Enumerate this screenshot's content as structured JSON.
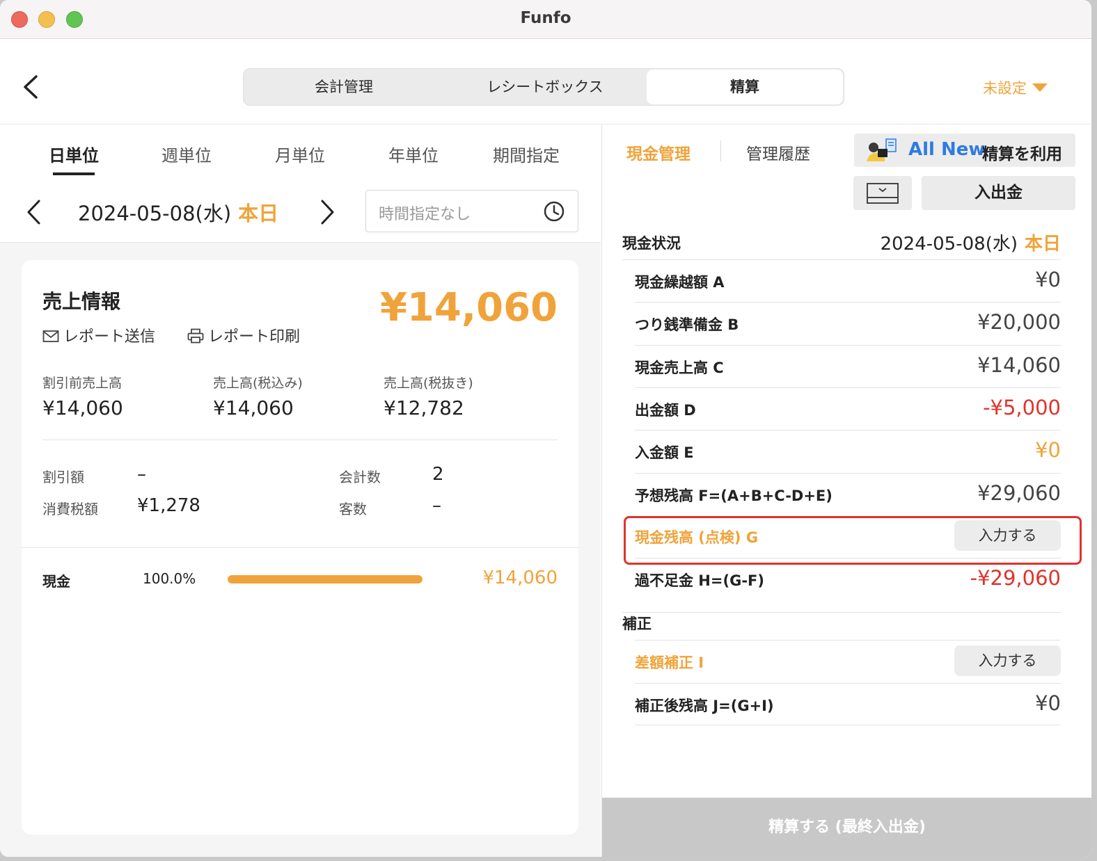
{
  "window": {
    "title": "Funfo"
  },
  "header": {
    "segments": [
      "会計管理",
      "レシートボックス",
      "精算"
    ],
    "unset_label": "未設定"
  },
  "left": {
    "period_tabs": [
      "日単位",
      "週単位",
      "月単位",
      "年単位",
      "期間指定"
    ],
    "date": "2024-05-08(水)",
    "today_label": "本日",
    "time_placeholder": "時間指定なし",
    "card": {
      "title": "売上情報",
      "total": "¥14,060",
      "report_send": "レポート送信",
      "report_print": "レポート印刷",
      "stats": [
        {
          "label": "割引前売上高",
          "value": "¥14,060"
        },
        {
          "label": "売上高(税込み)",
          "value": "¥14,060"
        },
        {
          "label": "売上高(税抜き)",
          "value": "¥12,782"
        }
      ],
      "discount_label": "割引額",
      "discount_value": "–",
      "tax_label": "消費税額",
      "tax_value": "¥1,278",
      "count_label": "会計数",
      "count_value": "2",
      "customers_label": "客数",
      "customers_value": "–",
      "payment": {
        "name": "現金",
        "percent": "100.0%",
        "fraction": 1.0,
        "amount": "¥14,060"
      }
    }
  },
  "right": {
    "tabs": [
      "現金管理",
      "管理履歴"
    ],
    "promo_new": "All New",
    "promo_text": "精算を利用",
    "io_button": "入出金",
    "status_header": "現金状況",
    "status_date": "2024-05-08(水)",
    "today_label": "本日",
    "rows": [
      {
        "label": "現金繰越額 A",
        "value": "¥0"
      },
      {
        "label": "つり銭準備金 B",
        "value": "¥20,000"
      },
      {
        "label": "現金売上高 C",
        "value": "¥14,060"
      },
      {
        "label": "出金額 D",
        "value": "-¥5,000"
      },
      {
        "label": "入金額 E",
        "value": "¥0"
      },
      {
        "label": "予想残高 F=(A+B+C-D+E)",
        "value": "¥29,060"
      },
      {
        "label": "現金残高 (点検) G",
        "button": "入力する"
      },
      {
        "label": "過不足金 H=(G-F)",
        "value": "-¥29,060"
      }
    ],
    "correction_header": "補正",
    "correction_rows": [
      {
        "label": "差額補正 I",
        "button": "入力する"
      },
      {
        "label": "補正後残高 J=(G+I)",
        "value": "¥0"
      }
    ],
    "settle_button": "精算する (最終入出金)"
  },
  "colors": {
    "accent": "#f0a33a",
    "negative": "#e0332c",
    "link": "#2f7be0"
  }
}
